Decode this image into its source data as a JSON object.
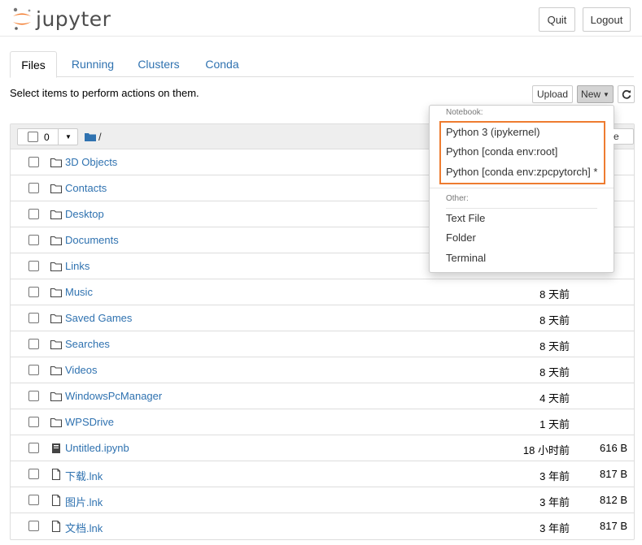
{
  "app": {
    "logo_text": "jupyter"
  },
  "header": {
    "quit_label": "Quit",
    "logout_label": "Logout"
  },
  "tabs": [
    {
      "label": "Files",
      "active": true
    },
    {
      "label": "Running"
    },
    {
      "label": "Clusters"
    },
    {
      "label": "Conda"
    }
  ],
  "toolbar": {
    "select_text": "Select items to perform actions on them.",
    "upload_label": "Upload",
    "new_label": "New"
  },
  "list_header": {
    "selected_count": "0",
    "path": "/"
  },
  "new_menu": {
    "notebook_heading": "Notebook:",
    "kernels": [
      "Python 3 (ipykernel)",
      "Python [conda env:root]",
      "Python [conda env:zpcpytorch] *"
    ],
    "other_heading": "Other:",
    "other_items": [
      "Text File",
      "Folder",
      "Terminal"
    ],
    "partial_button_text": "e"
  },
  "files": [
    {
      "name": "3D Objects",
      "type": "folder",
      "modified": "",
      "size": ""
    },
    {
      "name": "Contacts",
      "type": "folder",
      "modified": "",
      "size": ""
    },
    {
      "name": "Desktop",
      "type": "folder",
      "modified": "",
      "size": ""
    },
    {
      "name": "Documents",
      "type": "folder",
      "modified": "",
      "size": ""
    },
    {
      "name": "Links",
      "type": "folder",
      "modified": "",
      "size": ""
    },
    {
      "name": "Music",
      "type": "folder",
      "modified": "8 天前",
      "size": ""
    },
    {
      "name": "Saved Games",
      "type": "folder",
      "modified": "8 天前",
      "size": ""
    },
    {
      "name": "Searches",
      "type": "folder",
      "modified": "8 天前",
      "size": ""
    },
    {
      "name": "Videos",
      "type": "folder",
      "modified": "8 天前",
      "size": ""
    },
    {
      "name": "WindowsPcManager",
      "type": "folder",
      "modified": "4 天前",
      "size": ""
    },
    {
      "name": "WPSDrive",
      "type": "folder",
      "modified": "1 天前",
      "size": ""
    },
    {
      "name": "Untitled.ipynb",
      "type": "notebook",
      "modified": "18 小时前",
      "size": "616 B"
    },
    {
      "name": "下载.lnk",
      "type": "file",
      "modified": "3 年前",
      "size": "817 B"
    },
    {
      "name": "图片.lnk",
      "type": "file",
      "modified": "3 年前",
      "size": "812 B"
    },
    {
      "name": "文档.lnk",
      "type": "file",
      "modified": "3 年前",
      "size": "817 B"
    }
  ],
  "colors": {
    "link": "#2f72b0",
    "highlight": "#ee7c30",
    "logo_orange": "#f37726"
  }
}
